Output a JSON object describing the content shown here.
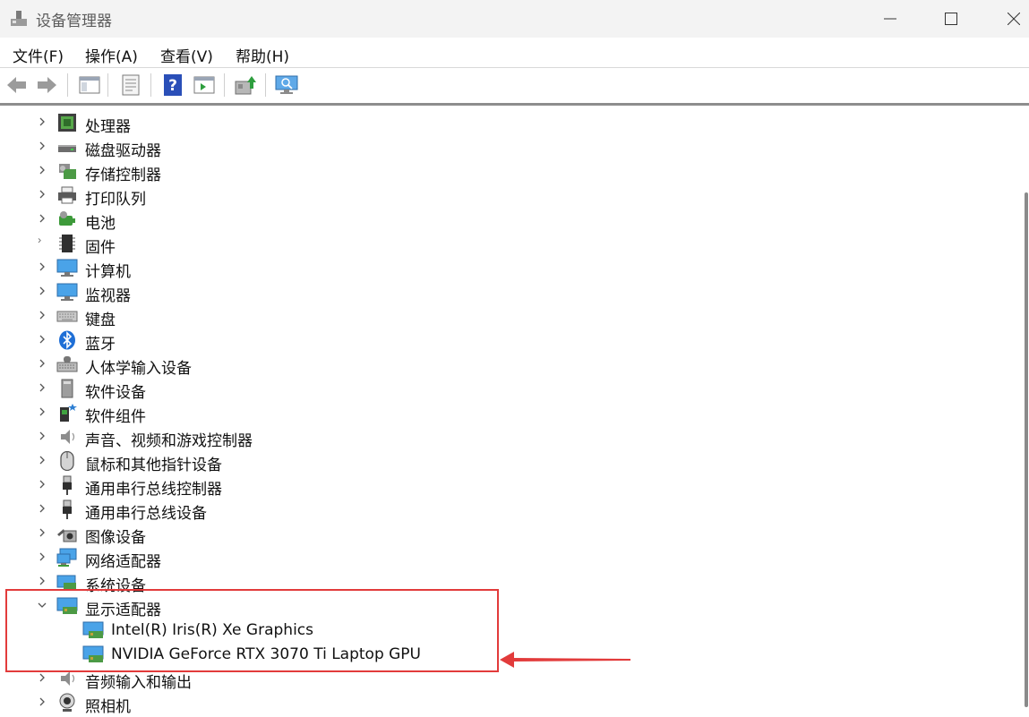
{
  "window": {
    "title": "设备管理器"
  },
  "menu": [
    {
      "label": "文件(F)"
    },
    {
      "label": "操作(A)"
    },
    {
      "label": "查看(V)"
    },
    {
      "label": "帮助(H)"
    }
  ],
  "tree": {
    "items": [
      {
        "label": "处理器",
        "icon": "processor-icon",
        "expanded": false
      },
      {
        "label": "磁盘驱动器",
        "icon": "disk-drive-icon",
        "expanded": false
      },
      {
        "label": "存储控制器",
        "icon": "storage-controller-icon",
        "expanded": false
      },
      {
        "label": "打印队列",
        "icon": "printer-icon",
        "expanded": false
      },
      {
        "label": "电池",
        "icon": "battery-icon",
        "expanded": false
      },
      {
        "label": "固件",
        "icon": "firmware-icon",
        "expanded": false
      },
      {
        "label": "计算机",
        "icon": "computer-icon",
        "expanded": false
      },
      {
        "label": "监视器",
        "icon": "monitor-icon",
        "expanded": false
      },
      {
        "label": "键盘",
        "icon": "keyboard-icon",
        "expanded": false
      },
      {
        "label": "蓝牙",
        "icon": "bluetooth-icon",
        "expanded": false
      },
      {
        "label": "人体学输入设备",
        "icon": "hid-icon",
        "expanded": false
      },
      {
        "label": "软件设备",
        "icon": "software-device-icon",
        "expanded": false
      },
      {
        "label": "软件组件",
        "icon": "software-component-icon",
        "expanded": false
      },
      {
        "label": "声音、视频和游戏控制器",
        "icon": "speaker-icon",
        "expanded": false
      },
      {
        "label": "鼠标和其他指针设备",
        "icon": "mouse-icon",
        "expanded": false
      },
      {
        "label": "通用串行总线控制器",
        "icon": "usb-icon",
        "expanded": false
      },
      {
        "label": "通用串行总线设备",
        "icon": "usb-icon",
        "expanded": false
      },
      {
        "label": "图像设备",
        "icon": "camera-device-icon",
        "expanded": false
      },
      {
        "label": "网络适配器",
        "icon": "network-adapter-icon",
        "expanded": false
      },
      {
        "label": "系统设备",
        "icon": "system-device-icon",
        "expanded": false
      },
      {
        "label": "显示适配器",
        "icon": "display-adapter-icon",
        "expanded": true
      },
      {
        "label": "音频输入和输出",
        "icon": "speaker-icon",
        "expanded": false
      },
      {
        "label": "照相机",
        "icon": "webcam-icon",
        "expanded": false
      }
    ],
    "display_adapters": [
      {
        "label": "Intel(R) Iris(R) Xe Graphics",
        "icon": "display-adapter-icon"
      },
      {
        "label": "NVIDIA GeForce RTX 3070 Ti Laptop GPU",
        "icon": "display-adapter-icon"
      }
    ]
  },
  "annotation": {
    "color": "#e23b3b"
  }
}
